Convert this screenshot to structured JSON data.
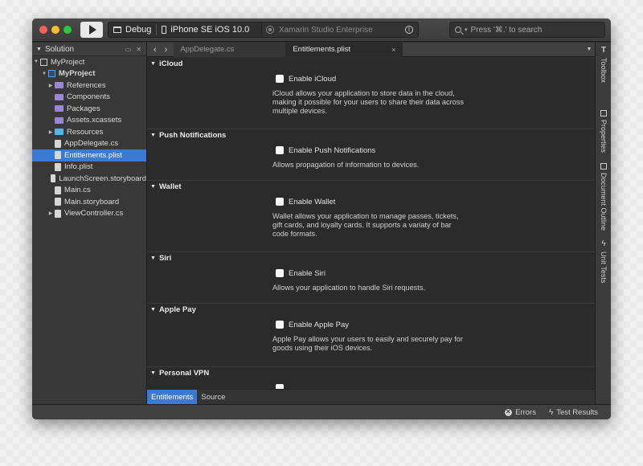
{
  "toolbar": {
    "configuration": "Debug",
    "device": "iPhone SE iOS 10.0",
    "status_text": "Xamarin Studio Enterprise",
    "search_placeholder": "Press '⌘.' to search"
  },
  "solution_pad": {
    "title": "Solution",
    "items": [
      {
        "label": "MyProject",
        "icon": "solution-icon"
      },
      {
        "label": "MyProject",
        "icon": "project-icon"
      },
      {
        "label": "References",
        "icon": "folder-icon"
      },
      {
        "label": "Components",
        "icon": "folder-icon"
      },
      {
        "label": "Packages",
        "icon": "folder-icon"
      },
      {
        "label": "Assets.xcassets",
        "icon": "folder-icon"
      },
      {
        "label": "Resources",
        "icon": "folder-icon"
      },
      {
        "label": "AppDelegate.cs",
        "icon": "file-icon"
      },
      {
        "label": "Entitlements.plist",
        "icon": "file-icon"
      },
      {
        "label": "Info.plist",
        "icon": "file-icon"
      },
      {
        "label": "LaunchScreen.storyboard",
        "icon": "file-icon"
      },
      {
        "label": "Main.cs",
        "icon": "file-icon"
      },
      {
        "label": "Main.storyboard",
        "icon": "file-icon"
      },
      {
        "label": "ViewController.cs",
        "icon": "file-icon"
      }
    ]
  },
  "tabs": [
    {
      "label": "AppDelegate.cs"
    },
    {
      "label": "Entitlements.plist"
    }
  ],
  "sections": [
    {
      "title": "iCloud",
      "checkbox": "Enable iCloud",
      "description": "iCloud allows your application to store data in the cloud,\nmaking it possible for your users to share their data across\nmultiple devices."
    },
    {
      "title": "Push Notifications",
      "checkbox": "Enable Push Notifications",
      "description": "Allows propagation of information to devices."
    },
    {
      "title": "Wallet",
      "checkbox": "Enable Wallet",
      "description": "Wallet allows your application to manage passes, tickets,\ngift cards, and loyalty cards. It supports a variaty of bar\ncode formats."
    },
    {
      "title": "Siri",
      "checkbox": "Enable Siri",
      "description": "Allows your application to handle Siri requests."
    },
    {
      "title": "Apple Pay",
      "checkbox": "Enable Apple Pay",
      "description": "Apple Pay allows your users to easily and securely pay for\ngoods using their iOS devices."
    },
    {
      "title": "Personal VPN",
      "checkbox": "",
      "description": ""
    }
  ],
  "bottom_tabs": {
    "entitlements": "Entitlements",
    "source": "Source"
  },
  "side_rail": {
    "toolbox": "Toolbox",
    "properties": "Properties",
    "document_outline": "Document Outline",
    "unit_tests": "Unit Tests"
  },
  "status_bar": {
    "errors": "Errors",
    "test_results": "Test Results"
  },
  "colors": {
    "accent": "#3b79d2",
    "close": "#fc5f57",
    "minimize": "#fdbc2e",
    "zoom": "#28c840"
  }
}
